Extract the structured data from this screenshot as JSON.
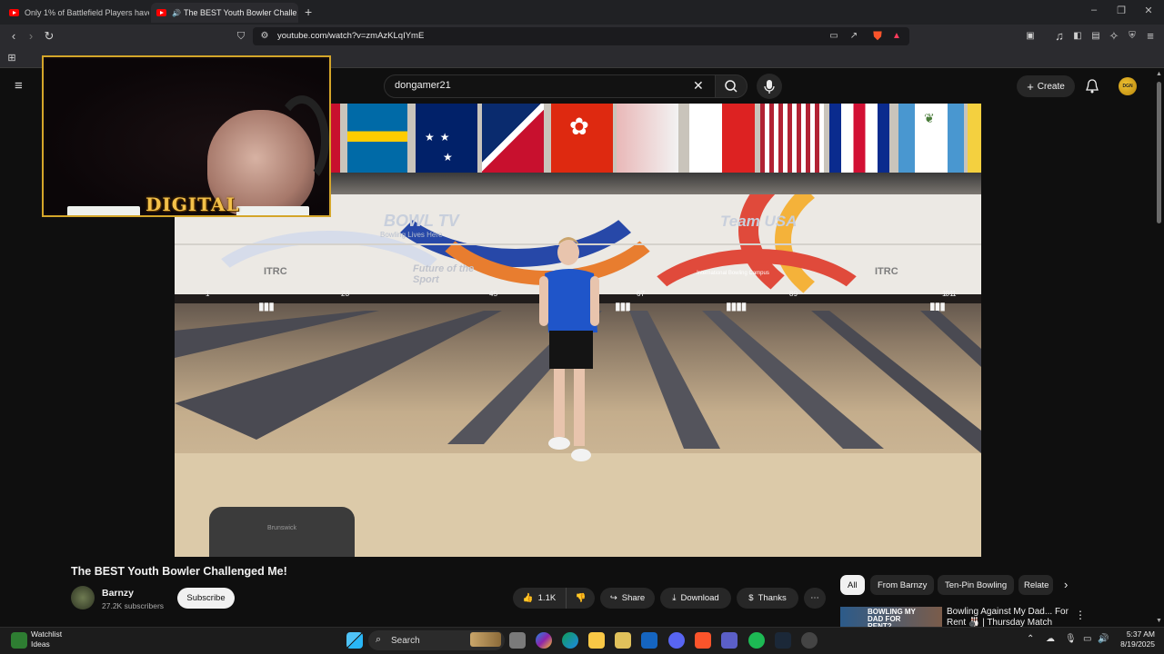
{
  "browser": {
    "tabs": [
      {
        "title": "Only 1% of Battlefield Players have th",
        "active": false
      },
      {
        "title": "The BEST Youth Bowler Challe",
        "active": true
      }
    ],
    "new_tab": "+",
    "url": "youtube.com/watch?v=zmAzKLqIYmE"
  },
  "youtube": {
    "search_value": "dongamer21",
    "create_label": "Create",
    "avatar_text": "DGN"
  },
  "webcam": {
    "overlay_title": "DIGITAL"
  },
  "video": {
    "banner_texts": [
      "BOWL TV",
      "Bowling Lives Here",
      "Team USA",
      "ITRC",
      "Future of the Sport",
      "International Bowling Campus",
      "ITRC"
    ],
    "lane_numbers": [
      "1",
      "2 3",
      "4 5",
      "6 7",
      "8 9",
      "10 11"
    ],
    "hood_label": "Brunswick"
  },
  "watch": {
    "title": "The BEST Youth Bowler Challenged Me!",
    "channel_name": "Barnzy",
    "subscribers": "27.2K subscribers",
    "subscribe_label": "Subscribe",
    "likes": "1.1K",
    "share_label": "Share",
    "download_label": "Download",
    "thanks_label": "Thanks",
    "more_label": "⋯"
  },
  "chips": [
    "All",
    "From Barnzy",
    "Ten-Pin Bowling",
    "Relate"
  ],
  "recommendation": {
    "thumb_text": "BOWLING MY DAD FOR RENT?",
    "title": "Bowling Against My Dad... For Rent 🎳 | Thursday Match"
  },
  "taskbar": {
    "watchlist_title": "Watchlist",
    "watchlist_sub": "Ideas",
    "search_label": "Search",
    "time": "5:37 AM",
    "date": "8/19/2025"
  },
  "colors": {
    "accent_red": "#ff0000",
    "cam_border": "#d4a62a",
    "background": "#0f0f0f"
  }
}
